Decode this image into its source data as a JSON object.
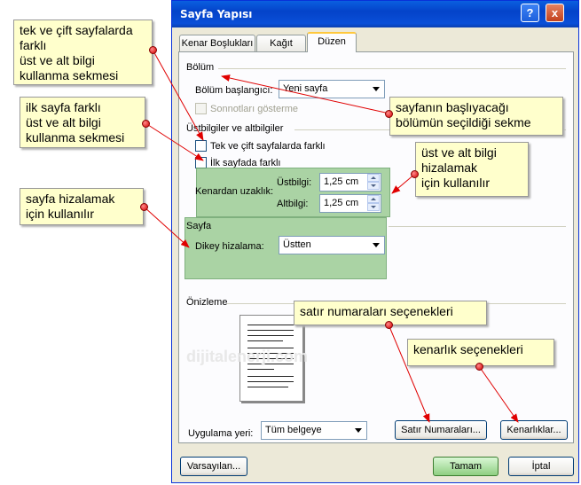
{
  "dialog": {
    "title": "Sayfa Yapısı",
    "help_label": "?",
    "close_label": "x",
    "tabs": [
      {
        "label": "Kenar Boşlukları"
      },
      {
        "label": "Kağıt"
      },
      {
        "label": "Düzen"
      }
    ],
    "section": {
      "heading": "Bölüm",
      "start_label": "Bölüm başlangıcı:",
      "start_value": "Yeni sayfa",
      "suppress_endnotes_label": "Sonnotları gösterme"
    },
    "headers_footers": {
      "heading": "Üstbilgiler ve altbilgiler",
      "odd_even_label": "Tek ve çift sayfalarda farklı",
      "first_page_label": "İlk sayfada farklı",
      "from_edge_label": "Kenardan uzaklık:",
      "header_label": "Üstbilgi:",
      "header_value": "1,25 cm",
      "footer_label": "Altbilgi:",
      "footer_value": "1,25 cm"
    },
    "page": {
      "heading": "Sayfa",
      "vertical_align_label": "Dikey hizalama:",
      "vertical_align_value": "Üstten"
    },
    "preview": {
      "heading": "Önizleme"
    },
    "apply": {
      "label": "Uygulama yeri:",
      "value": "Tüm belgeye"
    },
    "buttons": {
      "line_numbers": "Satır Numaraları...",
      "borders": "Kenarlıklar...",
      "default": "Varsayılan...",
      "ok": "Tamam",
      "cancel": "İptal"
    }
  },
  "watermark": "dijitalenerji.com",
  "callouts": {
    "odd_even": "tek ve çift sayfalarda\nfarklı\nüst ve alt bilgi\nkullanma sekmesi",
    "first_page": "ilk sayfa farklı\nüst ve alt bilgi\nkullanma sekmesi",
    "vertical_align": "sayfa hizalamak\niçin kullanılır",
    "section_start": "sayfanın başlıyacağı\nbölümün seçildiği sekme",
    "header_footer_align": "üst ve alt bilgi\nhizalamak\niçin kullanılır",
    "line_numbers": "satır numaraları seçenekleri",
    "borders": "kenarlık seçenekleri"
  },
  "colors": {
    "highlight": "#9ccc95",
    "callout_bg": "#ffffcc",
    "arrow": "#e00000",
    "titlebar": "#0a4fd8"
  }
}
